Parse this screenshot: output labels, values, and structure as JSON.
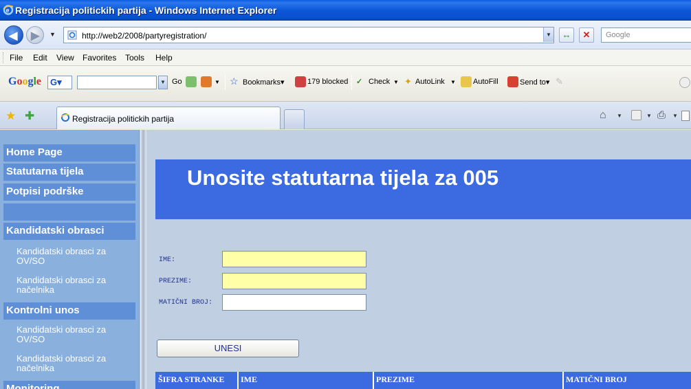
{
  "window": {
    "title": "Registracija politickih partija - Windows Internet Explorer"
  },
  "address_bar": {
    "url": "http://web2/2008/partyregistration/",
    "search_placeholder": "Google"
  },
  "menu": [
    "File",
    "Edit",
    "View",
    "Favorites",
    "Tools",
    "Help"
  ],
  "google_toolbar": {
    "logo": "Google",
    "go_label": "Go",
    "bookmarks_label": "Bookmarks▾",
    "blocked_label": "179 blocked",
    "check_label": "Check",
    "autolink_label": "AutoLink",
    "autofill_label": "AutoFill",
    "sendto_label": "Send to▾"
  },
  "tab": {
    "label": "Registracija politickih partija"
  },
  "sidebar": {
    "home": "Home Page",
    "statutarna": "Statutarna tijela",
    "potpisi": "Potpisi podrške",
    "kandidatski_head": "Kandidatski obrasci",
    "kandidatski_items": [
      "Kandidatski obrasci za OV/SO",
      "Kandidatski obrasci za načelnika"
    ],
    "kontrolni_head": "Kontrolni unos",
    "kontrolni_items": [
      "Kandidatski obrasci za OV/SO",
      "Kandidatski obrasci za načelnika"
    ],
    "monitoring_head": "Monitoring"
  },
  "main": {
    "heading": "Unosite statutarna tijela za 005",
    "form": {
      "ime_label": "IME:",
      "prezime_label": "PREZIME:",
      "maticni_label": "MATIČNI BROJ:",
      "ime_value": "",
      "prezime_value": "",
      "maticni_value": ""
    },
    "submit_label": "UNESI",
    "grid_columns": [
      "ŠIFRA STRANKE",
      "IME",
      "PREZIME",
      "MATIČNI BROJ"
    ]
  },
  "colors": {
    "banner": "#3c6ae0",
    "sidebar": "#8ab0dd",
    "nav_header": "#5f8fd6",
    "required_field": "#ffffa8"
  }
}
